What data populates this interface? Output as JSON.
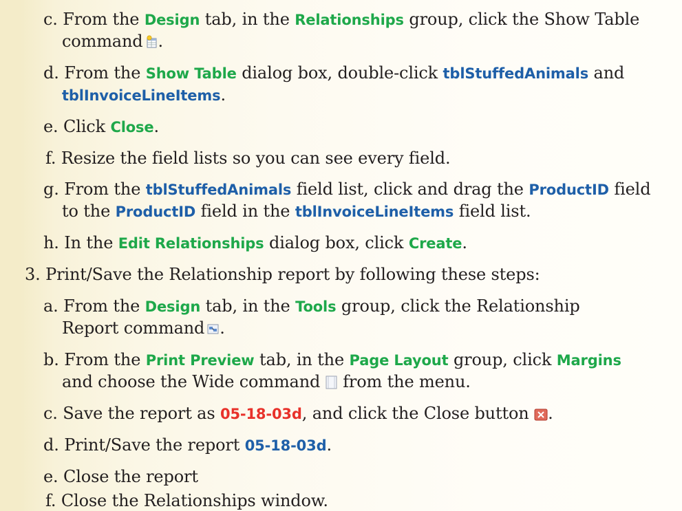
{
  "steps": {
    "c1": {
      "marker": "c.",
      "p1": "From the ",
      "tab": "Design",
      "p2": " tab, in the ",
      "group": "Relationships",
      "p3": " group, click the Show Table",
      "cont": "command",
      "end": "."
    },
    "d1": {
      "marker": "d.",
      "p1": "From the ",
      "dialog": "Show Table",
      "p2": " dialog box, double-click ",
      "table1": "tblStuffedAnimals",
      "p3": " and",
      "table2": "tblInvoiceLineItems",
      "end": "."
    },
    "e1": {
      "marker": "e.",
      "p1": "Click ",
      "button": "Close",
      "end": "."
    },
    "f1": {
      "marker": "f.",
      "text": "Resize the field lists so you can see every field."
    },
    "g1": {
      "marker": "g.",
      "p1": "From the ",
      "table1": "tblStuffedAnimals",
      "p2": " field list, click and drag the ",
      "field1": "ProductID",
      "p3": " field",
      "p4": "to the ",
      "field2": "ProductID",
      "p5": " field in the ",
      "table2": "tblInvoiceLineItems",
      "p6": " field list."
    },
    "h1": {
      "marker": "h.",
      "p1": "In the ",
      "dialog": "Edit Relationships",
      "p2": " dialog box, click ",
      "button": "Create",
      "end": "."
    },
    "s3": {
      "marker": "3.",
      "text": "Print/Save the Relationship report by following these steps:"
    },
    "a2": {
      "marker": "a.",
      "p1": "From the ",
      "tab": "Design",
      "p2": " tab, in the ",
      "group": "Tools",
      "p3": " group, click the Relationship",
      "cont": "Report command",
      "end": "."
    },
    "b2": {
      "marker": "b.",
      "p1": "From the ",
      "tab": "Print Preview",
      "p2": " tab, in the ",
      "group": "Page Layout",
      "p3": " group, click ",
      "cmd": "Margins",
      "p4": "and choose the Wide command ",
      "p5": " from the menu."
    },
    "c2": {
      "marker": "c.",
      "p1": "Save the report as ",
      "name": "05-18-03d",
      "p2": ", and click the Close button ",
      "end": "."
    },
    "d2": {
      "marker": "d.",
      "p1": "Print/Save the report ",
      "name": "05-18-03d",
      "end": "."
    },
    "e2": {
      "marker": "e.",
      "text": "Close the report"
    },
    "f2": {
      "marker": "f.",
      "text": "Close the Relationships window."
    }
  },
  "icons": [
    "show-table-icon",
    "relationship-report-icon",
    "wide-margins-icon",
    "close-x-icon"
  ],
  "colors": {
    "command_green": "#1ea84a",
    "object_blue": "#1e5fa8",
    "filename_red": "#e8312a",
    "page_tint": "#f4ecc9"
  }
}
